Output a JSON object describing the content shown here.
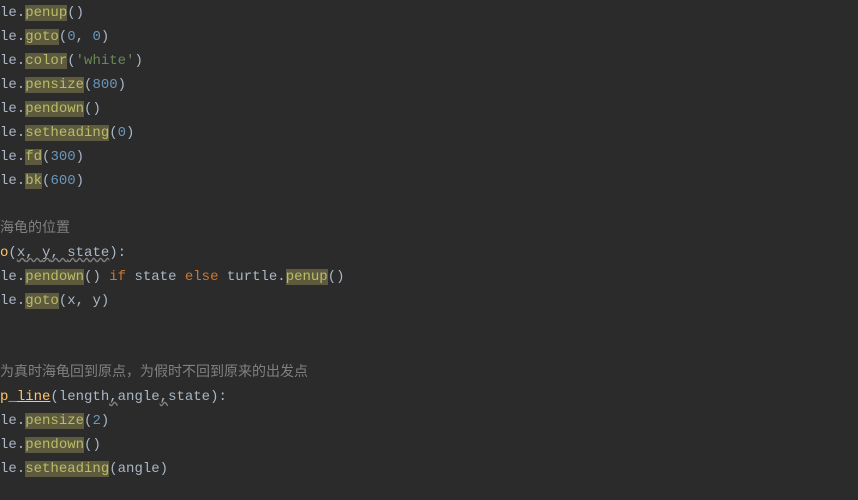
{
  "lines": {
    "l1": {
      "prefix": "le.",
      "method": "penup",
      "args_open": "(",
      "args_close": ")"
    },
    "l2": {
      "prefix": "le.",
      "method": "goto",
      "args_open": "(",
      "a1": "0",
      "sep": ", ",
      "a2": "0",
      "args_close": ")"
    },
    "l3": {
      "prefix": "le.",
      "method": "color",
      "args_open": "(",
      "str": "'white'",
      "args_close": ")"
    },
    "l4": {
      "prefix": "le.",
      "method": "pensize",
      "args_open": "(",
      "a1": "800",
      "args_close": ")"
    },
    "l5": {
      "prefix": "le.",
      "method": "pendown",
      "args_open": "(",
      "args_close": ")"
    },
    "l6": {
      "prefix": "le.",
      "method": "setheading",
      "args_open": "(",
      "a1": "0",
      "args_close": ")"
    },
    "l7": {
      "prefix": "le.",
      "method": "fd",
      "args_open": "(",
      "a1": "300",
      "args_close": ")"
    },
    "l8": {
      "prefix": "le.",
      "method": "bk",
      "args_open": "(",
      "a1": "600",
      "args_close": ")"
    },
    "c1": "海龟的位置",
    "d1": {
      "name_prefix": "o",
      "open": "(",
      "p1": "x",
      "sep1": ", ",
      "p2": "y",
      "sep2": ", ",
      "p3": "state",
      "close": "):"
    },
    "l9": {
      "prefix": "le.",
      "method": "pendown",
      "args_open": "(",
      "args_close": ") ",
      "kw1": "if",
      "mid": " state ",
      "kw2": "else",
      "tail_prefix": " turtle.",
      "tail_method": "penup",
      "tail_open": "(",
      "tail_close": ")"
    },
    "l10": {
      "prefix": "le.",
      "method": "goto",
      "args_open": "(",
      "a1": "x",
      "sep": ", ",
      "a2": "y",
      "args_close": ")"
    },
    "c2": "为真时海龟回到原点，为假时不回到原来的出发点",
    "d2": {
      "name_prefix": "p_",
      "name": "line",
      "open": "(",
      "p1": "length",
      "sep1": ",",
      "p2": "angle",
      "sep2": ",",
      "p3": "state",
      "close": "):"
    },
    "l11": {
      "prefix": "le.",
      "method": "pensize",
      "args_open": "(",
      "a1": "2",
      "args_close": ")"
    },
    "l12": {
      "prefix": "le.",
      "method": "pendown",
      "args_open": "(",
      "args_close": ")"
    },
    "l13": {
      "prefix": "le.",
      "method": "setheading",
      "args_open": "(",
      "a1": "angle",
      "args_close": ")"
    }
  }
}
